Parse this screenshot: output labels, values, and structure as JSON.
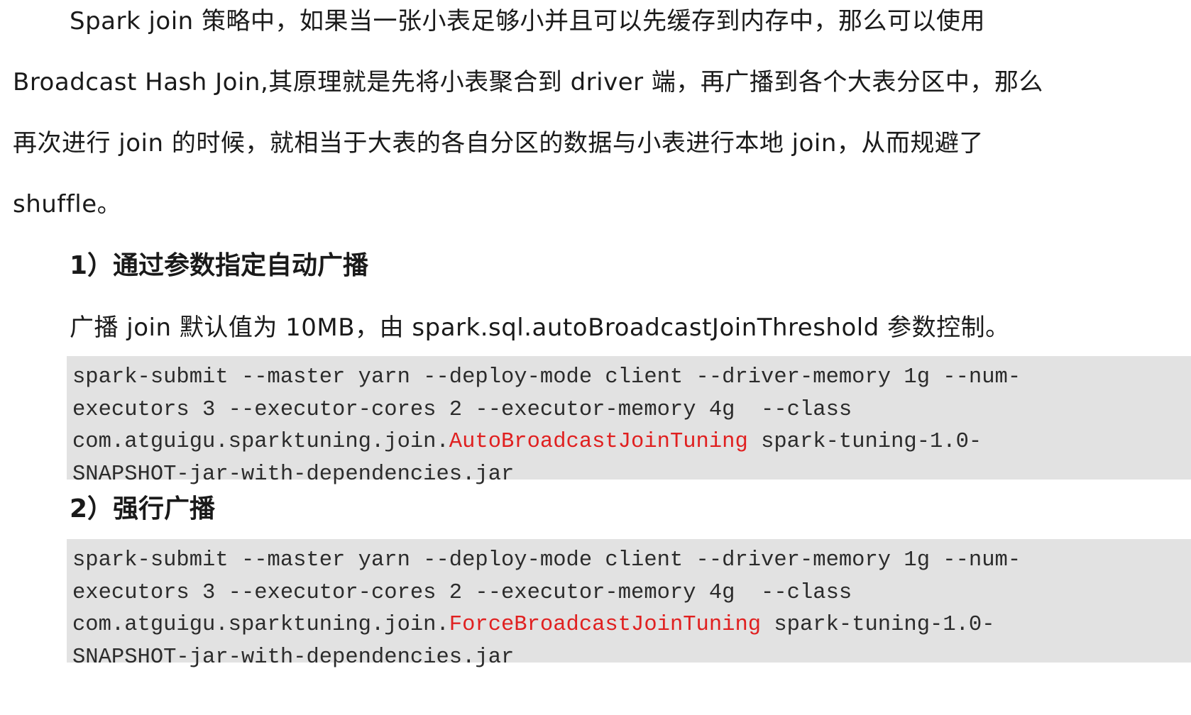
{
  "intro": {
    "line1": "Spark  join  策略中，如果当一张小表足够小并且可以先缓存到内存中，那么可以使用",
    "line2": "Broadcast Hash Join,其原理就是先将小表聚合到 driver 端，再广播到各个大表分区中，那么",
    "line3": "再次进行  join  的时候，就相当于大表的各自分区的数据与小表进行本地  join，从而规避了",
    "line4": "shuffle。"
  },
  "section1": {
    "heading": "1）通过参数指定自动广播",
    "description": "广播 join 默认值为 10MB，由 spark.sql.autoBroadcastJoinThreshold 参数控制。",
    "code": {
      "line1": "spark-submit --master yarn --deploy-mode client --driver-memory 1g --num-",
      "line2": "executors 3 --executor-cores 2 --executor-memory 4g  --class",
      "line3_prefix": "com.atguigu.sparktuning.join.",
      "line3_highlight": "AutoBroadcastJoinTuning",
      "line3_suffix": " spark-tuning-1.0-",
      "line4": "SNAPSHOT-jar-with-dependencies.jar"
    }
  },
  "section2": {
    "heading": "2）强行广播",
    "code": {
      "line1": "spark-submit --master yarn --deploy-mode client --driver-memory 1g --num-",
      "line2": "executors 3 --executor-cores 2 --executor-memory 4g  --class",
      "line3_prefix": "com.atguigu.sparktuning.join.",
      "line3_highlight": "ForceBroadcastJoinTuning",
      "line3_suffix": " spark-tuning-1.0-",
      "line4": "SNAPSHOT-jar-with-dependencies.jar"
    }
  },
  "colors": {
    "code_background": "#e2e2e2",
    "highlight": "#e02020",
    "text": "#1a1a1a"
  }
}
